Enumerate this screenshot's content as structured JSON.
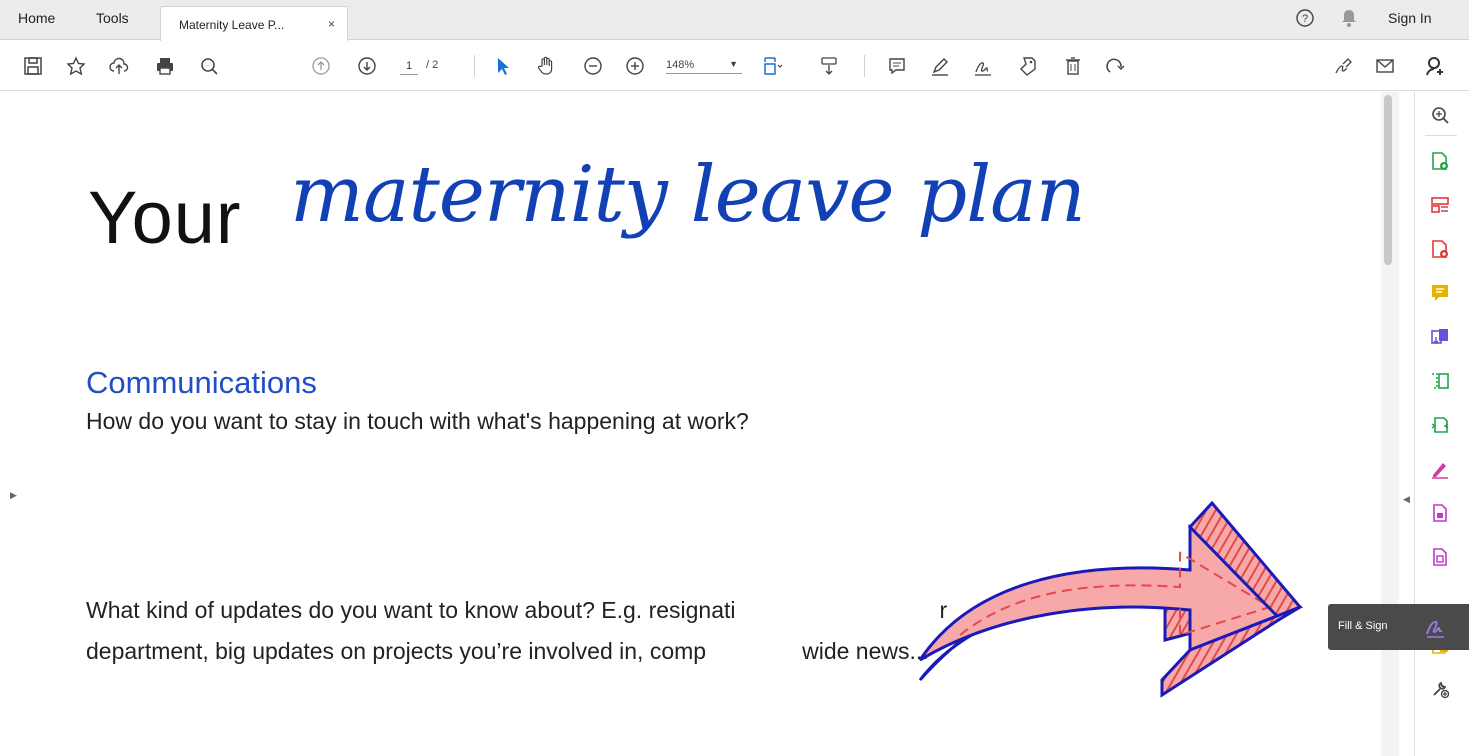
{
  "menubar": {
    "home_label": "Home",
    "tools_label": "Tools",
    "tab_title": "Maternity Leave P...",
    "tab_close": "×",
    "help_icon": "question-circle-icon",
    "bell_icon": "bell-icon",
    "sign_in_label": "Sign In"
  },
  "toolbar": {
    "icons": [
      "save-icon",
      "bookmark-star-icon",
      "upload-cloud-icon",
      "print-icon",
      "zoom-search-icon",
      "page-up-icon",
      "page-down-icon",
      "select-cursor-icon",
      "hand-icon",
      "zoom-out-icon",
      "zoom-in-icon",
      "fit-page-icon",
      "scroll-mode-icon",
      "comment-icon",
      "highlight-pen-icon",
      "sign-icon",
      "stamp-icon",
      "delete-icon",
      "rotate-icon",
      "link-icon",
      "email-icon",
      "add-user-icon"
    ],
    "current_page": "1",
    "total_pages": "/ 2",
    "zoom_value": "148%"
  },
  "document": {
    "title_plain": "Your",
    "title_script": "maternity leave plan",
    "section_heading": "Communications",
    "question_1": "How do you want to stay in touch with what's happening at work?",
    "question_2_line1": "What kind of updates do you want to know about? E.g. resignati",
    "question_2_tail": "r",
    "question_2_line2": "department, big updates on projects you’re involved in, comp",
    "question_2_line2_tail": "wide news..."
  },
  "rail": {
    "items": [
      {
        "icon": "zoom-icon",
        "color": "#444444"
      },
      {
        "icon": "create-pdf-icon",
        "color": "#22a44a"
      },
      {
        "icon": "organize-icon",
        "color": "#e03a3a"
      },
      {
        "icon": "export-pdf-icon",
        "color": "#e03a3a"
      },
      {
        "icon": "comment-icon",
        "color": "#e9b200"
      },
      {
        "icon": "combine-icon",
        "color": "#6a4fd8"
      },
      {
        "icon": "compress-icon",
        "color": "#22a44a"
      },
      {
        "icon": "scan-icon",
        "color": "#22a44a"
      },
      {
        "icon": "sign-icon",
        "color": "#d63aa0"
      },
      {
        "icon": "protect-icon",
        "color": "#c236c8"
      },
      {
        "icon": "prepare-form-icon",
        "color": "#c236c8"
      },
      {
        "icon": "send-icon",
        "color": "#e9b200"
      },
      {
        "icon": "more-tools-icon",
        "color": "#444444"
      }
    ],
    "fill_sign_label": "Fill & Sign",
    "fill_sign_color": "#7d4fd8"
  },
  "colors": {
    "script_blue": "#1240b5",
    "heading_blue": "#1f4fc2",
    "arrow_fill": "#f7a8a8",
    "arrow_outline": "#1a1ab8",
    "arrow_stripes": "#e34a4a"
  }
}
